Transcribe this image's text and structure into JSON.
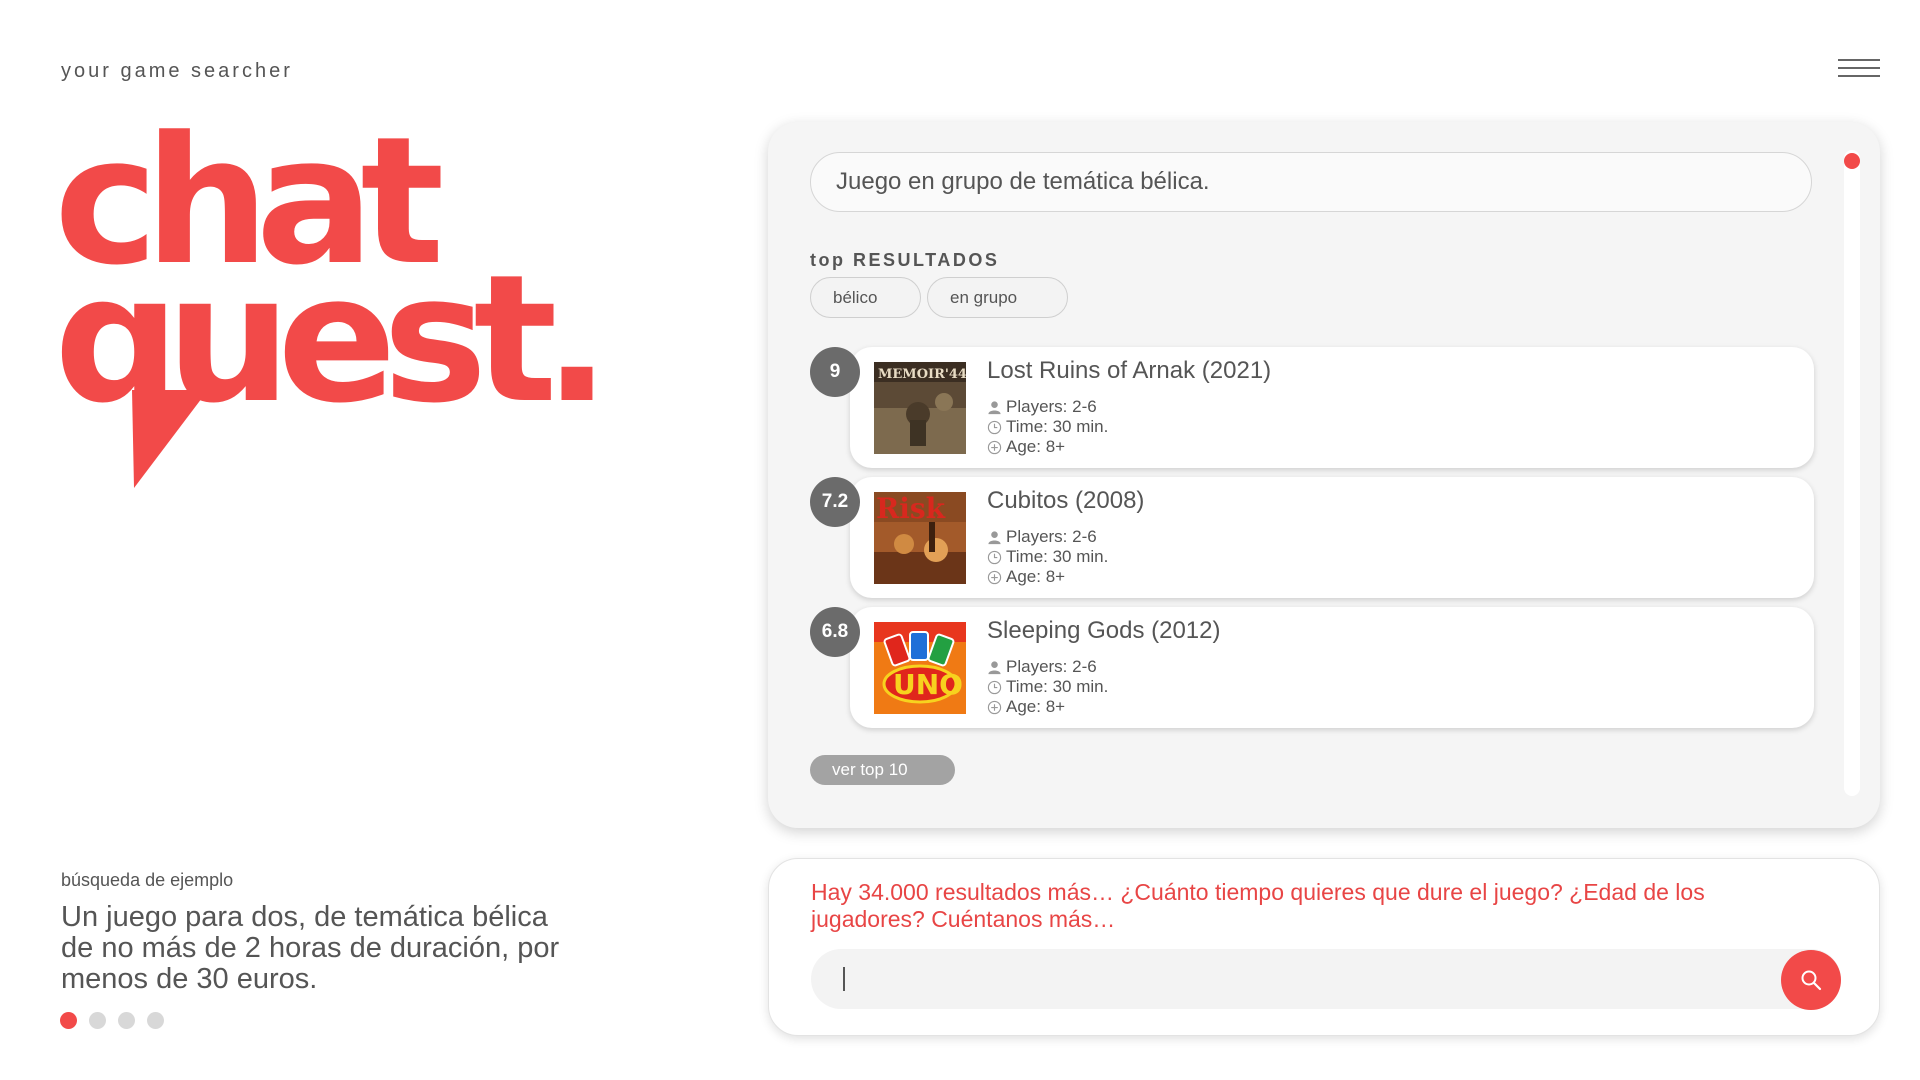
{
  "header": {
    "tagline": "your game searcher",
    "menu_icon": "hamburger-menu-icon"
  },
  "logo": {
    "line1": "chat",
    "line2": "quest.",
    "color": "#f24a49"
  },
  "example": {
    "label": "búsqueda de ejemplo",
    "text": "Un juego para dos, de temática bélica de no más de 2 horas de duración, por menos de 30 euros.",
    "dots_total": 4,
    "active_dot": 1
  },
  "results": {
    "query": "Juego en grupo de temática bélica.",
    "heading_prefix": "top",
    "heading_main": "RESULTADOS",
    "tags": [
      "bélico",
      "en grupo"
    ],
    "items": [
      {
        "score": "9",
        "title": "Lost Ruins of Arnak (2021)",
        "players": "Players: 2-6",
        "time": "Time: 30 min.",
        "age": "Age: 8+",
        "thumb_icon": "memoir-44-box-art",
        "thumb_label": "MEMOIR'44"
      },
      {
        "score": "7.2",
        "title": "Cubitos (2008)",
        "players": "Players: 2-6",
        "time": "Time: 30 min.",
        "age": "Age: 8+",
        "thumb_icon": "risk-box-art",
        "thumb_label": "Risk"
      },
      {
        "score": "6.8",
        "title": "Sleeping Gods (2012)",
        "players": "Players: 2-6",
        "time": "Time: 30 min.",
        "age": "Age: 8+",
        "thumb_icon": "uno-box-art",
        "thumb_label": "UNO"
      }
    ],
    "see_top_label": "ver top 10"
  },
  "chat": {
    "message": "Hay 34.000 resultados más… ¿Cuánto tiempo quieres que dure el juego? ¿Edad de los jugadores? Cuéntanos más…",
    "input_value": "",
    "send_icon": "search-icon"
  },
  "colors": {
    "accent": "#f24a49",
    "panel_bg": "#f5f5f5",
    "score_bg": "#6b6b6b",
    "text": "#555555"
  }
}
